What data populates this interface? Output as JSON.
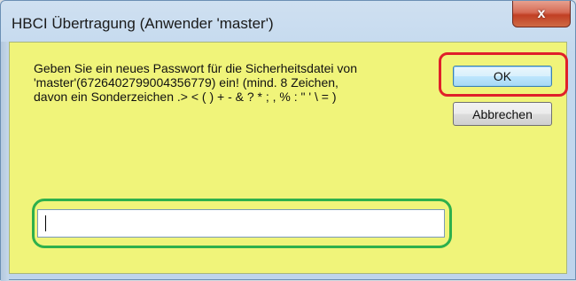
{
  "window": {
    "title": "HBCI Übertragung (Anwender 'master')",
    "close_label": "x"
  },
  "message": {
    "line1": "Geben Sie ein neues Passwort für die Sicherheitsdatei von",
    "line2": "'master'(6726402799004356779) ein! (mind. 8 Zeichen,",
    "line3": "davon ein Sonderzeichen .> < ( ) + - & ? * ; , % : \" ' \\ = )"
  },
  "buttons": {
    "ok_label": "OK",
    "cancel_label": "Abbrechen"
  },
  "password_input": {
    "value": ""
  },
  "colors": {
    "client_background": "#f0f47a",
    "ok_highlight": "#e0202a",
    "input_highlight": "#2eb04c"
  },
  "icons": {
    "close": "close-icon"
  }
}
